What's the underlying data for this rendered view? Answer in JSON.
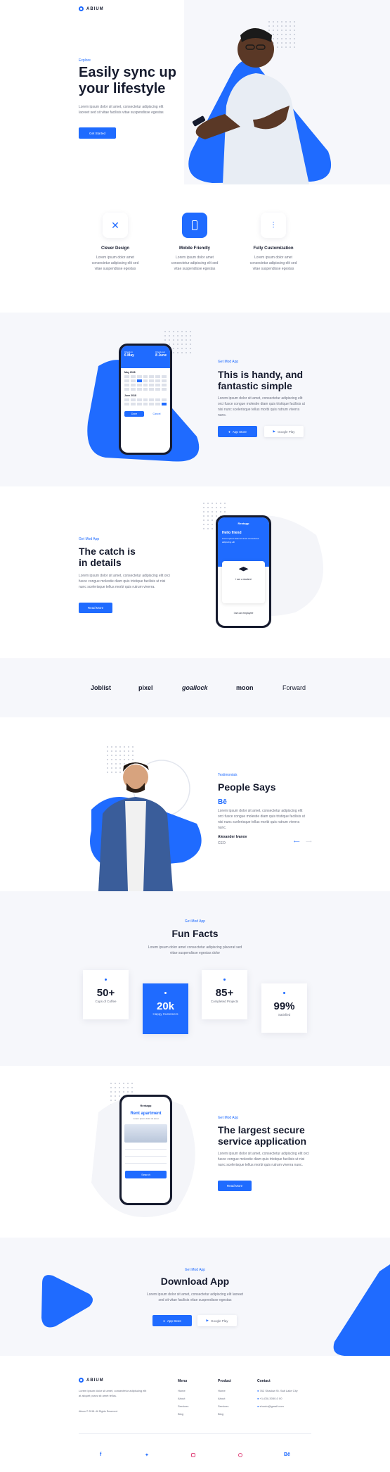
{
  "brand": {
    "name": "ABIUM"
  },
  "hero": {
    "eyebrow": "Explore",
    "title_line1": "Easily sync up",
    "title_line2": "your lifestyle",
    "text": "Lorem ipsum dolor sit amet, consectetur adipiscing elit laoreet sed sit vitae facilisis vitae suspendisse egestas",
    "button": "Get Started"
  },
  "features": [
    {
      "title": "Clever Design",
      "text": "Lorem ipsum dolor amet consectetur adipiscing elit sed vitae suspendisse egestas",
      "icon": "tools-icon"
    },
    {
      "title": "Mobile Friendly",
      "text": "Lorem ipsum dolor amet consectetur adipiscing elit sed vitae suspendisse egestas",
      "icon": "mobile-icon"
    },
    {
      "title": "Fully Customization",
      "text": "Lorem ipsum dolor amet consectetur adipiscing elit sed vitae suspendisse egestas",
      "icon": "sliders-icon"
    }
  ],
  "handy": {
    "eyebrow": "Get Mod App",
    "title_line1": "This is handy, and",
    "title_line2": "fantastic simple",
    "text": "Lorem ipsum dolor sit amet, consectetur adipiscing elit orci fusce congue molestie diam quis tristique facilisis ut nisi nunc scelerisque tellus morbi quis rutrum viverra nunc.",
    "app_store": "App Store",
    "google_play": "Google Play"
  },
  "calendar": {
    "from_label": "Check-in",
    "from": "6 May",
    "to_label": "Check-out",
    "to": "8 June",
    "month1": "May 2018",
    "month2": "June 2018",
    "done": "Done",
    "cancel": "Cancel"
  },
  "catch": {
    "eyebrow": "Get Mod App",
    "title_line1": "The catch is",
    "title_line2": "in details",
    "text": "Lorem ipsum dolor sit amet, consectetur adipiscing elit orci fusce congue molestie diam quis tristique facilisis ut nisi nunc scelerisque tellus morbi quis rutrum viverra.",
    "button": "Read More"
  },
  "phone2": {
    "app": "Rentapp",
    "greeting": "Hello friend",
    "sub": "Lorem ipsum dolor sit amet consectetur adipiscing elit",
    "role1": "I am a student",
    "role2": "I am an employee"
  },
  "logos": [
    "Joblist",
    "pixel",
    "goallock",
    "moon",
    "Forward"
  ],
  "testimonial": {
    "eyebrow": "Testimonials",
    "title": "People Says",
    "quote_mark": "Bē",
    "text": "Lorem ipsum dolor sit amet, consectetur adipiscing elit orci fusce congue molestie diam quis tristique facilisis ut nisi nunc scelerisque tellus morbi quis rutrum viverra nunc.",
    "name": "Alexander Ivanov",
    "role": "CEO"
  },
  "facts": {
    "eyebrow": "Get Mod App",
    "title": "Fun Facts",
    "text": "Lorem ipsum dolor amet consectetur adipiscing placerat sed vitae suspendisse egestas dolor",
    "items": [
      {
        "value": "50+",
        "label": "Cups of Coffee"
      },
      {
        "value": "20k",
        "label": "Happy Customers"
      },
      {
        "value": "85+",
        "label": "Completed Projects"
      },
      {
        "value": "99%",
        "label": "Satisfied"
      }
    ]
  },
  "secure": {
    "eyebrow": "Get Mod App",
    "title_line1": "The largest secure",
    "title_line2": "service application",
    "text": "Lorem ipsum dolor sit amet, consectetur adipiscing elit orci fusce congue molestie diam quis tristique facilisis ut nisi nunc scelerisque tellus morbi quis rutrum viverra nunc.",
    "button": "Read More"
  },
  "phone3": {
    "app": "Rentapp",
    "title": "Rent apartment",
    "sub": "Lorem ipsum dolor sit amet",
    "search": "Search"
  },
  "download": {
    "eyebrow": "Get Mod App",
    "title": "Download App",
    "text": "Lorem ipsum dolor sit amet, consectetur adipiscing elit laoreet sed sit vitae facilisis vitae suspendisse egestas",
    "app_store": "App Store",
    "google_play": "Google Play"
  },
  "footer": {
    "about": "Lorem ipsum dolor sit amet, consectetur adipiscing elit at aliquet purus sit amet tellus.",
    "copyright": "Abium © 2018. All Rights Reserved.",
    "menu_title": "Menu",
    "menu": [
      "Home",
      "About",
      "Services",
      "Blog"
    ],
    "product_title": "Product",
    "product": [
      "Home",
      "About",
      "Services",
      "Blog"
    ],
    "contact_title": "Contact",
    "contact": [
      "762 Shadow St. Salt Lake City",
      "+1 (00) 3050-0 00",
      "shouto@gmail.com"
    ]
  },
  "social": [
    "facebook-icon",
    "twitter-icon",
    "instagram-icon",
    "pinterest-icon",
    "behance-icon"
  ],
  "colors": {
    "accent": "#1f6bff",
    "dark": "#161b2e"
  }
}
